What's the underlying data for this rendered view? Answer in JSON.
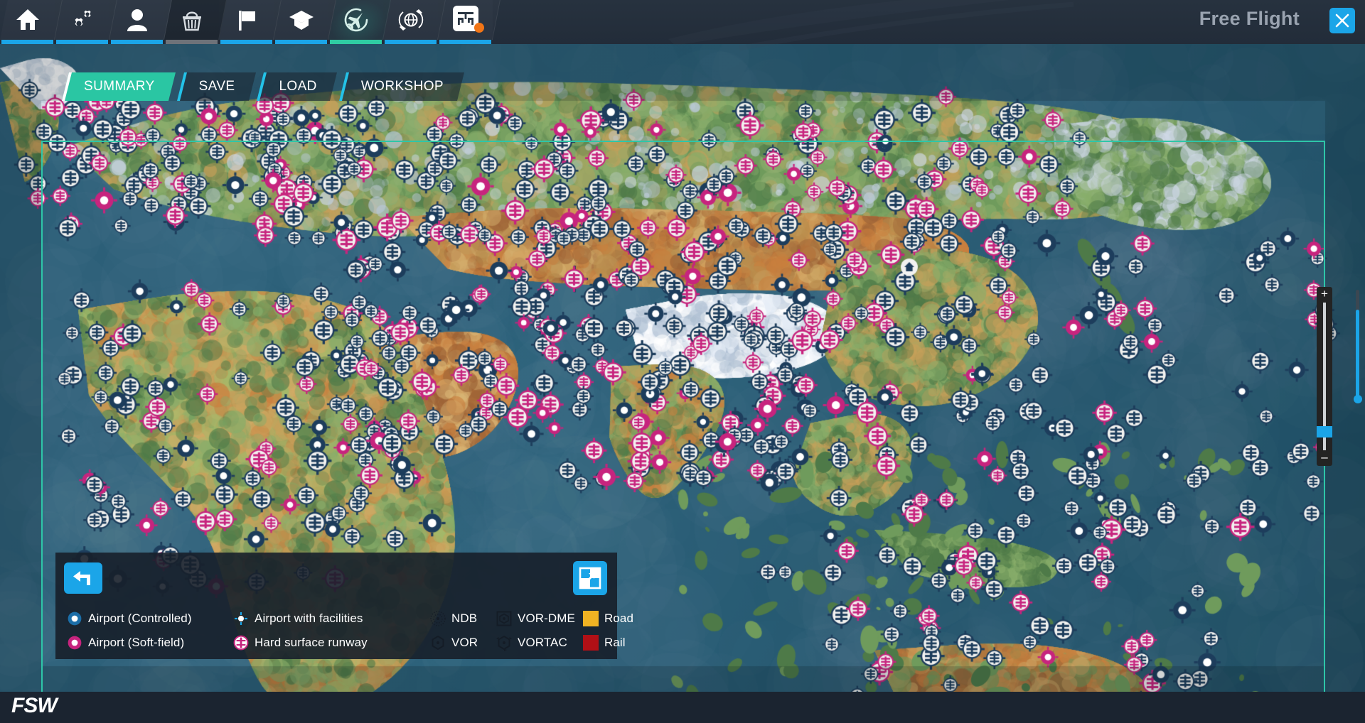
{
  "window": {
    "title": "Free Flight",
    "close_label": "×",
    "close_icon": "close-x-icon",
    "brand": "FSW"
  },
  "topnav": {
    "items": [
      {
        "icon": "home-icon",
        "name": "home",
        "underline": "#1ba5e8",
        "state": "normal"
      },
      {
        "icon": "gears-icon",
        "name": "settings",
        "underline": "#1ba5e8",
        "state": "normal"
      },
      {
        "icon": "person-icon",
        "name": "profile",
        "underline": "#1ba5e8",
        "state": "normal"
      },
      {
        "icon": "basket-icon",
        "name": "store",
        "underline": "#6e7279",
        "state": "shaded"
      },
      {
        "icon": "flag-icon",
        "name": "challenges",
        "underline": "#1ba5e8",
        "state": "normal"
      },
      {
        "icon": "graduation-cap-icon",
        "name": "training",
        "underline": "#1ba5e8",
        "state": "normal"
      },
      {
        "icon": "plane-circle-icon",
        "name": "free-flight",
        "underline": "#2fcca3",
        "state": "active"
      },
      {
        "icon": "globe-plane-icon",
        "name": "world",
        "underline": "#1ba5e8",
        "state": "normal"
      },
      {
        "icon": "logo-badge-icon",
        "name": "extras",
        "underline": "#1ba5e8",
        "state": "normal",
        "badge": true
      }
    ]
  },
  "tabs": [
    {
      "label": "SUMMARY",
      "active": true
    },
    {
      "label": "SAVE",
      "active": false
    },
    {
      "label": "LOAD",
      "active": false
    },
    {
      "label": "WORKSHOP",
      "active": false
    }
  ],
  "legend": {
    "back_icon": "back-arrow-icon",
    "expand_icon": "expand-fullscreen-icon",
    "rows": [
      [
        {
          "label": "Airport (Controlled)",
          "icon": "airport-controlled-icon",
          "color": "#1b6ea8",
          "col": "col-a"
        },
        {
          "label": "Airport with facilities",
          "icon": "airport-facilities-icon",
          "color": "#1ba5e8",
          "col": "col-b"
        },
        {
          "label": "NDB",
          "icon": "ndb-icon",
          "color": "#1b2430",
          "col": "col-c"
        },
        {
          "label": "VOR-DME",
          "icon": "vor-dme-icon",
          "color": "#1b2430",
          "col": "col-d"
        },
        {
          "label": "Road",
          "icon": "road-swatch",
          "color": "#f0b323",
          "col": "col-e"
        }
      ],
      [
        {
          "label": "Airport (Soft-field)",
          "icon": "airport-softfield-icon",
          "color": "#c7247e",
          "col": "col-a"
        },
        {
          "label": "Hard surface runway",
          "icon": "hard-surface-runway-icon",
          "color": "#c7247e",
          "col": "col-b"
        },
        {
          "label": "VOR",
          "icon": "vor-icon",
          "color": "#1b2430",
          "col": "col-c"
        },
        {
          "label": "VORTAC",
          "icon": "vortac-icon",
          "color": "#1b2430",
          "col": "col-d"
        },
        {
          "label": "Rail",
          "icon": "rail-swatch",
          "color": "#b01016",
          "col": "col-e"
        }
      ]
    ]
  },
  "zoom_control": {
    "plus_label": "+",
    "minus_label": "–",
    "handle_position_pct": 78
  },
  "map": {
    "frame_color": "#2ec6a8",
    "ocean_color": "#2a6079",
    "view": "world-terrain"
  }
}
